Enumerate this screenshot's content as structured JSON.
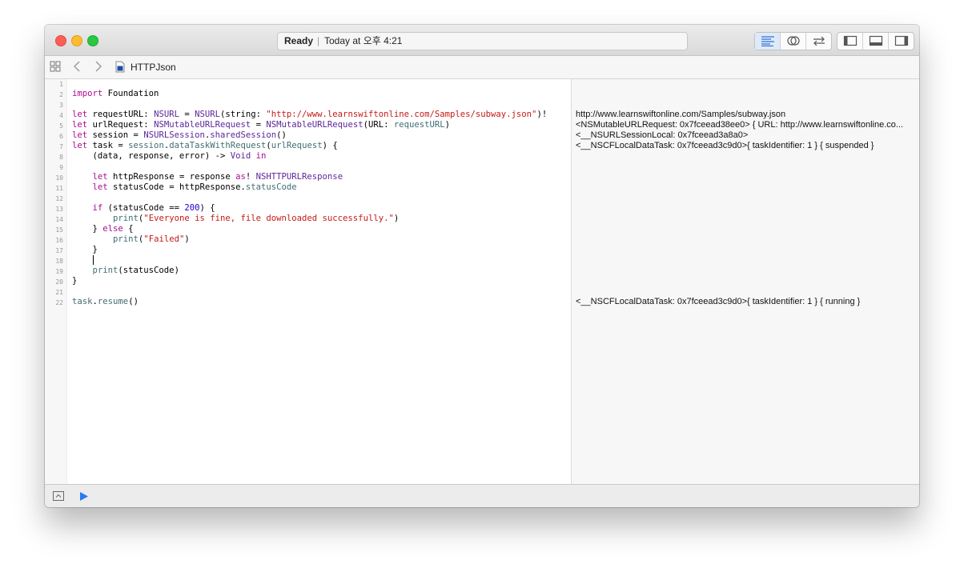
{
  "window": {
    "status": "Ready",
    "separator": "|",
    "timestamp": "Today at 오후 4:21"
  },
  "jumpbar": {
    "file_name": "HTTPJson"
  },
  "toolbar_icons": [
    "standard-editor-icon",
    "assistant-editor-icon",
    "version-editor-icon",
    "navigator-toggle-icon",
    "debug-area-toggle-icon",
    "utilities-toggle-icon"
  ],
  "line_numbers": [
    "1",
    "2",
    "3",
    "4",
    "5",
    "6",
    "7",
    "8",
    "9",
    "10",
    "11",
    "12",
    "13",
    "14",
    "15",
    "16",
    "17",
    "18",
    "19",
    "20",
    "21",
    "22"
  ],
  "code": {
    "l2": [
      "import",
      " Foundation"
    ],
    "l4": [
      "let",
      " requestURL: ",
      "NSURL",
      " = ",
      "NSURL",
      "(string: ",
      "\"http://www.learnswiftonline.com/Samples/subway.json\"",
      ")!"
    ],
    "l5": [
      "let",
      " urlRequest: ",
      "NSMutableURLRequest",
      " = ",
      "NSMutableURLRequest",
      "(URL: ",
      "requestURL",
      ")"
    ],
    "l6": [
      "let",
      " session = ",
      "NSURLSession",
      ".",
      "sharedSession",
      "()"
    ],
    "l7": [
      "let",
      " task = ",
      "session",
      ".",
      "dataTaskWithRequest",
      "(",
      "urlRequest",
      ") {"
    ],
    "l8": [
      "    (data, response, error) -> ",
      "Void",
      " ",
      "in"
    ],
    "l10": [
      "    ",
      "let",
      " httpResponse = response ",
      "as",
      "! ",
      "NSHTTPURLResponse"
    ],
    "l11": [
      "    ",
      "let",
      " statusCode = httpResponse.",
      "statusCode"
    ],
    "l13": [
      "    ",
      "if",
      " (statusCode == ",
      "200",
      ") {"
    ],
    "l14": [
      "        ",
      "print",
      "(",
      "\"Everyone is fine, file downloaded successfully.\"",
      ")"
    ],
    "l15": [
      "    } ",
      "else",
      " {"
    ],
    "l16": [
      "        ",
      "print",
      "(",
      "\"Failed\"",
      ")"
    ],
    "l17": [
      "    }"
    ],
    "l19": [
      "    ",
      "print",
      "(statusCode)"
    ],
    "l20": [
      "}"
    ],
    "l22": [
      "task",
      ".",
      "resume",
      "()"
    ]
  },
  "results": {
    "r4": "http://www.learnswiftonline.com/Samples/subway.json",
    "r5": "<NSMutableURLRequest: 0x7fceead38ee0> { URL: http://www.learnswiftonline.co...",
    "r6": "<__NSURLSessionLocal: 0x7fceead3a8a0>",
    "r7": "<__NSCFLocalDataTask: 0x7fceead3c9d0>{ taskIdentifier: 1 } { suspended }",
    "r22": "<__NSCFLocalDataTask: 0x7fceead3c9d0>{ taskIdentifier: 1 } { running }"
  },
  "colors": {
    "keyword": "#aa0d91",
    "type": "#5c2699",
    "property": "#3f6e74",
    "string": "#c41a16",
    "number": "#1c00cf",
    "run_button": "#2a7af0"
  }
}
